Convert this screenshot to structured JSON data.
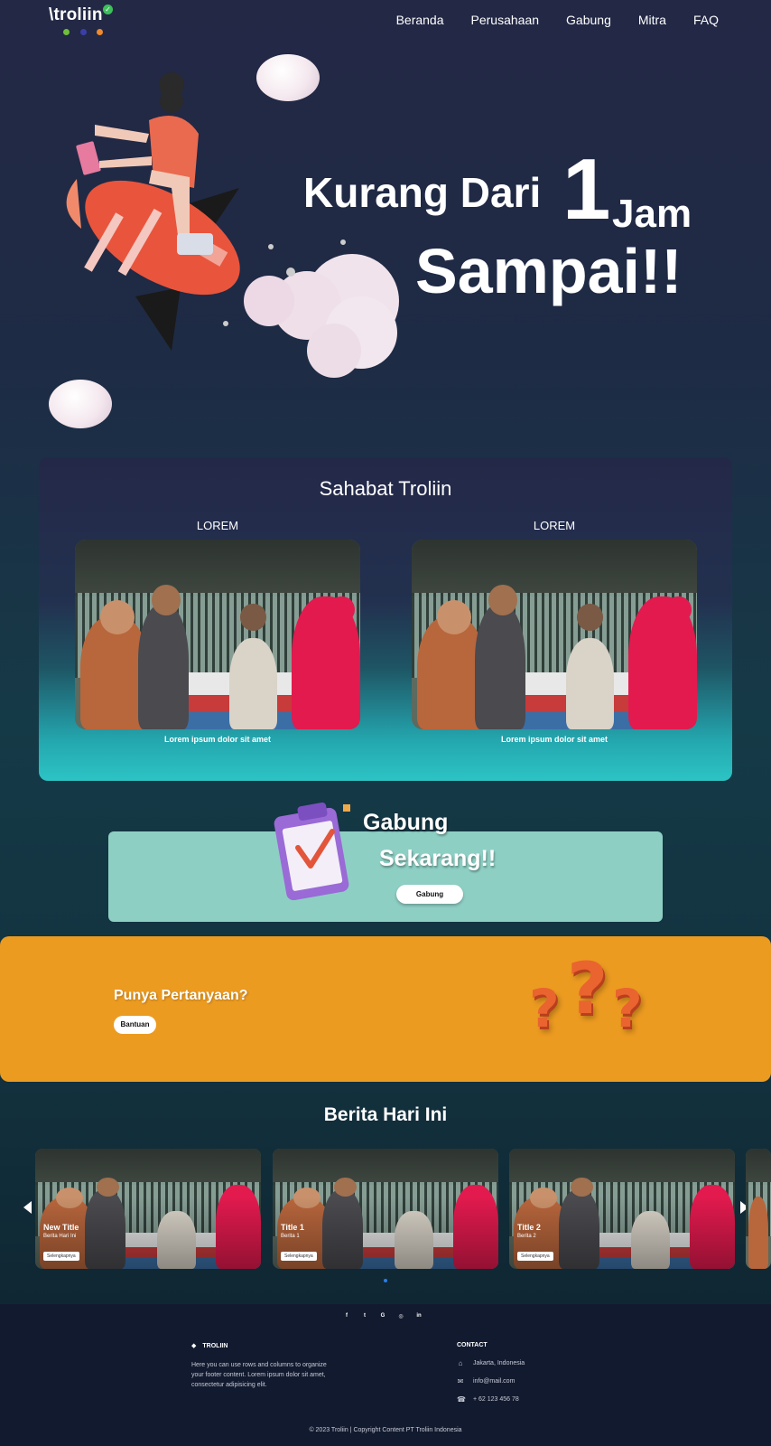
{
  "nav": {
    "logo_text": "\\troliin",
    "links": [
      "Beranda",
      "Perusahaan",
      "Gabung",
      "Mitra",
      "FAQ"
    ]
  },
  "hero": {
    "line1": "Kurang Dari",
    "number": "1",
    "jam": "Jam",
    "line2": "Sampai!!"
  },
  "sahabat": {
    "title": "Sahabat Troliin",
    "cards": [
      {
        "label": "LOREM",
        "caption": "Lorem ipsum dolor sit amet"
      },
      {
        "label": "LOREM",
        "caption": "Lorem ipsum dolor sit amet"
      }
    ]
  },
  "gabung": {
    "title_line1": "Gabung",
    "title_line2": "Sekarang!!",
    "button": "Gabung"
  },
  "faq": {
    "title": "Punya Pertanyaan?",
    "button": "Bantuan"
  },
  "news": {
    "title": "Berita Hari Ini",
    "cards": [
      {
        "title": "New Title",
        "subtitle": "Berita Hari Ini",
        "button": "Selengkapnya"
      },
      {
        "title": "Title 1",
        "subtitle": "Berita 1",
        "button": "Selengkapnya"
      },
      {
        "title": "Title 2",
        "subtitle": "Berita 2",
        "button": "Selengkapnya"
      }
    ]
  },
  "footer": {
    "social": [
      "f",
      "t",
      "G",
      "◎",
      "in"
    ],
    "brand": "TROLIIN",
    "about": "Here you can use rows and columns to organize your footer content. Lorem ipsum dolor sit amet, consectetur adipisicing elit.",
    "contact_title": "CONTACT",
    "address": "Jakarta, Indonesia",
    "email": "info@mail.com",
    "phone": "+ 62 123 456 78",
    "copyright": "© 2023 Troliin | Copyright Content PT Troliin Indonesia"
  },
  "colors": {
    "accent_teal": "#2cc4c4",
    "gabung_bg": "#8ecfc4",
    "faq_bg": "#ec9b21",
    "footer_bg": "#121a2f"
  }
}
